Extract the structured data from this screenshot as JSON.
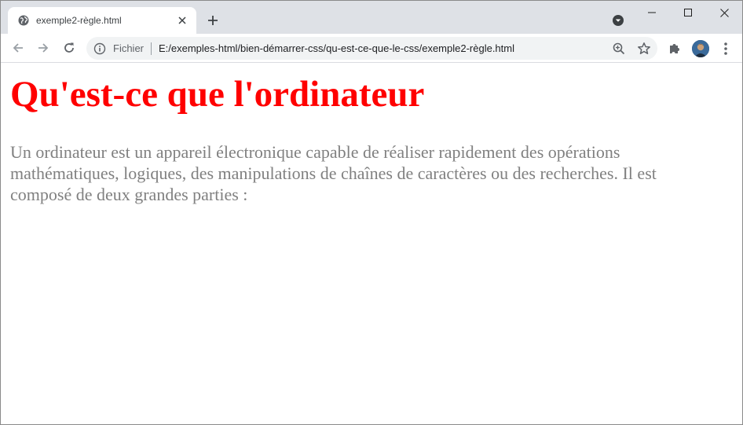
{
  "browser": {
    "tab": {
      "title": "exemple2-règle.html",
      "favicon": "globe-icon"
    },
    "address_bar": {
      "security_label": "Fichier",
      "url": "E:/exemples-html/bien-démarrer-css/qu-est-ce-que-le-css/exemple2-règle.html"
    }
  },
  "page": {
    "heading": "Qu'est-ce que l'ordinateur",
    "paragraph": "Un ordinateur est un appareil électronique capable de réaliser rapidement des opérations mathématiques, logiques, des manipulations de chaînes de caractères ou des recherches. Il est composé de deux grandes parties :"
  },
  "colors": {
    "heading": "#ff0000",
    "paragraph": "#808080",
    "tabstrip": "#dee1e6"
  }
}
